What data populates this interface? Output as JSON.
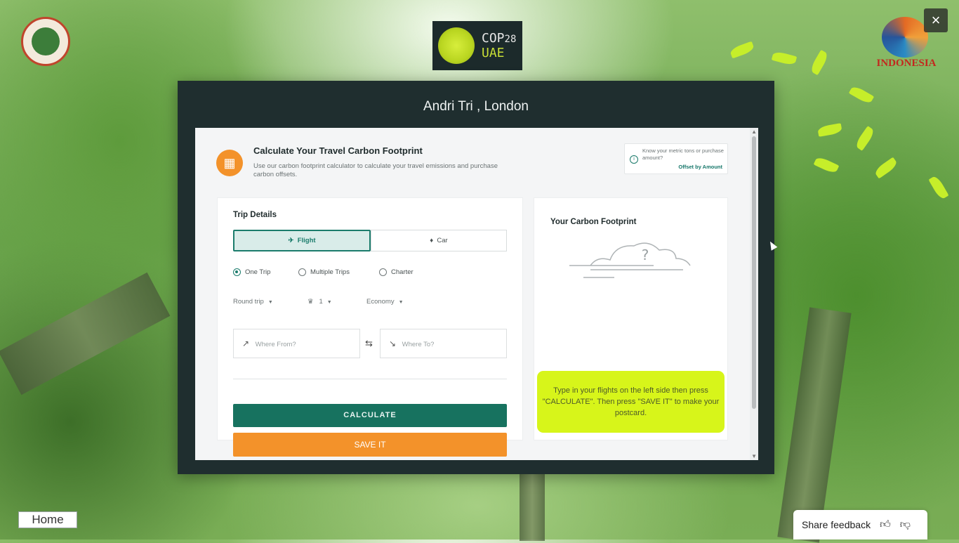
{
  "header": {
    "cop_logo_line1": "COP",
    "cop_logo_line1_num": "28",
    "cop_logo_line2": "UAE",
    "indonesia_logo_text": "INDONESIA",
    "close_label": "×"
  },
  "modal": {
    "title": "Andri Tri , London"
  },
  "calculator": {
    "header_icon": "calculator-icon",
    "title": "Calculate Your Travel Carbon Footprint",
    "description": "Use our carbon footprint calculator to calculate your travel emissions and purchase carbon offsets.",
    "offset": {
      "text": "Know your metric tons or purchase amount?",
      "link": "Offset by Amount"
    },
    "trip": {
      "title": "Trip Details",
      "modes": [
        {
          "label": "Flight",
          "icon": "plane-icon",
          "selected": true
        },
        {
          "label": "Car",
          "icon": "car-icon",
          "selected": false
        }
      ],
      "trip_types": [
        {
          "label": "One Trip",
          "selected": true
        },
        {
          "label": "Multiple Trips",
          "selected": false
        },
        {
          "label": "Charter",
          "selected": false
        }
      ],
      "round_trip": "Round trip",
      "passengers": "1",
      "cabin": "Economy",
      "from_placeholder": "Where From?",
      "to_placeholder": "Where To?"
    },
    "buttons": {
      "calculate": "CALCULATE",
      "save": "SAVE IT"
    },
    "footprint": {
      "title": "Your Carbon Footprint",
      "cloud_mark": "?",
      "note": "Type in your flights on the left side then press \"CALCULATE\". Then press \"SAVE IT\" to make your postcard."
    }
  },
  "footer": {
    "home": "Home",
    "feedback": "Share feedback",
    "like_icon": "thumbs-up-icon",
    "dislike_icon": "thumbs-down-icon"
  },
  "colors": {
    "modal_bg": "#1f2e2f",
    "accent_green": "#17725f",
    "accent_orange": "#f3922a",
    "note_yellow": "#d7f51a"
  }
}
